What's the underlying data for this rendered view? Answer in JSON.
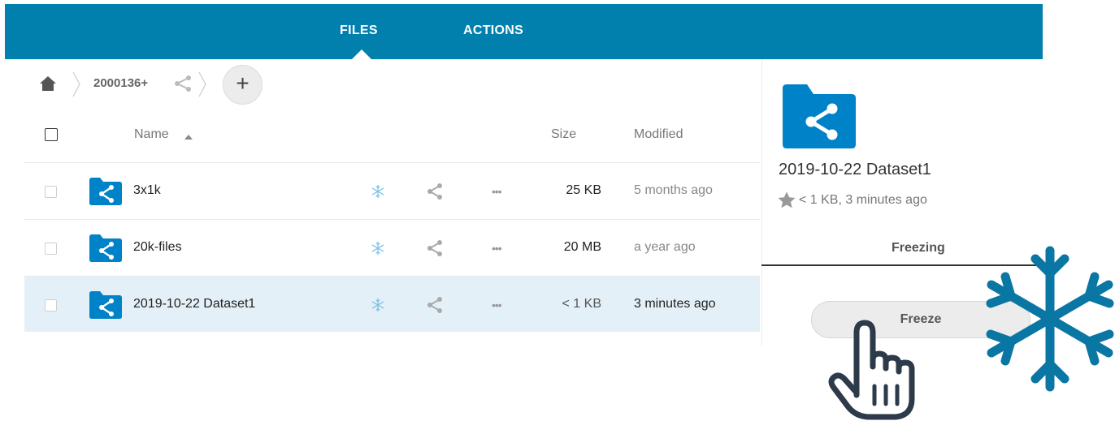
{
  "nav": {
    "tabs": [
      {
        "label": "FILES",
        "active": true
      },
      {
        "label": "ACTIONS",
        "active": false
      }
    ]
  },
  "breadcrumb": {
    "current": "2000136+"
  },
  "toolbar": {
    "add_label": "+"
  },
  "table": {
    "headers": {
      "name": "Name",
      "size": "Size",
      "modified": "Modified"
    },
    "rows": [
      {
        "name": "3x1k",
        "size": "25 KB",
        "modified": "5 months ago",
        "selected": false
      },
      {
        "name": "20k-files",
        "size": "20 MB",
        "modified": "a year ago",
        "selected": false
      },
      {
        "name": "2019-10-22 Dataset1",
        "size": "< 1 KB",
        "modified": "3 minutes ago",
        "selected": true
      }
    ],
    "more_label": "•••"
  },
  "sidebar": {
    "title": "2019-10-22 Dataset1",
    "meta": "< 1 KB, 3 minutes ago",
    "active_tab": "Freezing",
    "freeze_button": "Freeze"
  },
  "icons": {
    "home": "home-icon",
    "share": "share-icon",
    "folder": "shared-folder-icon",
    "freeze": "snowflake-icon",
    "favorite": "star-icon",
    "more": "more-options-icon",
    "pointer": "hand-pointer-icon"
  },
  "colors": {
    "brand": "#0180ad",
    "folder": "#0082c9",
    "selected_row": "#e4f0f7",
    "snowflake": "#0a76a3"
  }
}
